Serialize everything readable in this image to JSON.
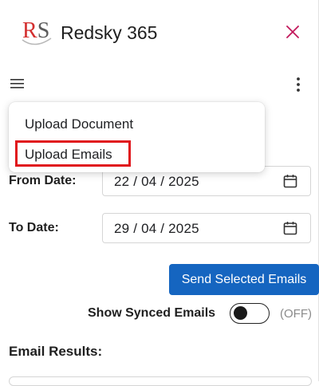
{
  "header": {
    "logo_letters": {
      "first": "R",
      "second": "S"
    },
    "app_title": "Redsky 365",
    "close_icon": "close-icon",
    "brand_colors": {
      "red": "#d32f2f",
      "close": "#c2185b"
    }
  },
  "toolbar": {
    "menu_icon": "hamburger-menu-icon",
    "more_icon": "more-vertical-icon"
  },
  "menu": {
    "items": [
      {
        "label": "Upload Document"
      },
      {
        "label": "Upload Emails",
        "highlighted": true
      }
    ],
    "highlight_color": "#e0161c"
  },
  "form": {
    "from_label": "From Date:",
    "from_value": "22 / 04 / 2025",
    "to_label": "To Date:",
    "to_value": "29 / 04 / 2025",
    "calendar_icon": "calendar-icon",
    "send_button": "Send Selected Emails",
    "send_button_color": "#1565c0",
    "synced_label": "Show Synced Emails",
    "synced_on": false,
    "synced_state_text": "(OFF)"
  },
  "results": {
    "heading": "Email Results:"
  }
}
